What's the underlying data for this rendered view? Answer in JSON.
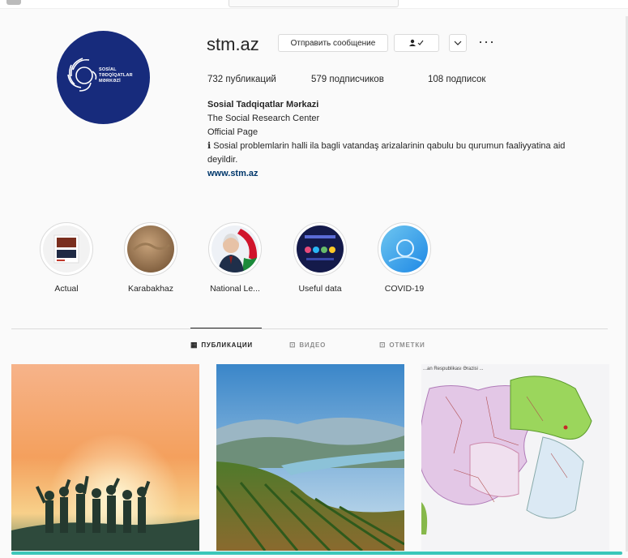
{
  "profile": {
    "username": "stm.az",
    "message_button": "Отправить сообщение",
    "follow_icon": "person-check-icon",
    "more_icon": "chevron-down-icon",
    "options_icon": "more-options-icon",
    "options_label": "···",
    "avatar_text": "SOSİAL\nTƏDQİQATLAR\nMƏRKƏZİ"
  },
  "stats": {
    "posts": "732 публикаций",
    "followers": "579 подписчиков",
    "following": "108 подписок"
  },
  "bio": {
    "name": "Sosial Tadqiqatlar Mərkazi",
    "line1": "The Social Research Center",
    "line2": "Official Page",
    "line3": "ℹ Sosial problemlarin halli ila bagli vatandaş arizalarinin qabulu bu qurumun faaliyyatina aid deyildir.",
    "link": "www.stm.az"
  },
  "highlights": [
    {
      "label": "Actual"
    },
    {
      "label": "Karabakhaz"
    },
    {
      "label": "National Le..."
    },
    {
      "label": "Useful data"
    },
    {
      "label": "COVID-19"
    }
  ],
  "tabs": {
    "posts": "ПУБЛИКАЦИИ",
    "video": "ВИДЕО",
    "tagged": "ОТМЕТКИ"
  },
  "posts": [
    {
      "name": "sunset-silhouettes"
    },
    {
      "name": "vineyard-mountains"
    },
    {
      "name": "azerbaijan-map",
      "caption": "...an Respublikası Ərazisi ..."
    }
  ],
  "colors": {
    "avatar_bg": "#172b7c",
    "link": "#00376b",
    "accent_bottom": "#3cc7b9"
  }
}
